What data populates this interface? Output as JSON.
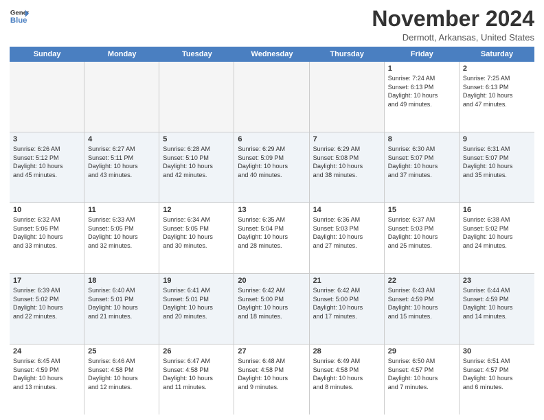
{
  "logo": {
    "line1": "General",
    "line2": "Blue"
  },
  "title": "November 2024",
  "location": "Dermott, Arkansas, United States",
  "header_days": [
    "Sunday",
    "Monday",
    "Tuesday",
    "Wednesday",
    "Thursday",
    "Friday",
    "Saturday"
  ],
  "weeks": [
    [
      {
        "day": "",
        "info": ""
      },
      {
        "day": "",
        "info": ""
      },
      {
        "day": "",
        "info": ""
      },
      {
        "day": "",
        "info": ""
      },
      {
        "day": "",
        "info": ""
      },
      {
        "day": "1",
        "info": "Sunrise: 7:24 AM\nSunset: 6:13 PM\nDaylight: 10 hours\nand 49 minutes."
      },
      {
        "day": "2",
        "info": "Sunrise: 7:25 AM\nSunset: 6:13 PM\nDaylight: 10 hours\nand 47 minutes."
      }
    ],
    [
      {
        "day": "3",
        "info": "Sunrise: 6:26 AM\nSunset: 5:12 PM\nDaylight: 10 hours\nand 45 minutes."
      },
      {
        "day": "4",
        "info": "Sunrise: 6:27 AM\nSunset: 5:11 PM\nDaylight: 10 hours\nand 43 minutes."
      },
      {
        "day": "5",
        "info": "Sunrise: 6:28 AM\nSunset: 5:10 PM\nDaylight: 10 hours\nand 42 minutes."
      },
      {
        "day": "6",
        "info": "Sunrise: 6:29 AM\nSunset: 5:09 PM\nDaylight: 10 hours\nand 40 minutes."
      },
      {
        "day": "7",
        "info": "Sunrise: 6:29 AM\nSunset: 5:08 PM\nDaylight: 10 hours\nand 38 minutes."
      },
      {
        "day": "8",
        "info": "Sunrise: 6:30 AM\nSunset: 5:07 PM\nDaylight: 10 hours\nand 37 minutes."
      },
      {
        "day": "9",
        "info": "Sunrise: 6:31 AM\nSunset: 5:07 PM\nDaylight: 10 hours\nand 35 minutes."
      }
    ],
    [
      {
        "day": "10",
        "info": "Sunrise: 6:32 AM\nSunset: 5:06 PM\nDaylight: 10 hours\nand 33 minutes."
      },
      {
        "day": "11",
        "info": "Sunrise: 6:33 AM\nSunset: 5:05 PM\nDaylight: 10 hours\nand 32 minutes."
      },
      {
        "day": "12",
        "info": "Sunrise: 6:34 AM\nSunset: 5:05 PM\nDaylight: 10 hours\nand 30 minutes."
      },
      {
        "day": "13",
        "info": "Sunrise: 6:35 AM\nSunset: 5:04 PM\nDaylight: 10 hours\nand 28 minutes."
      },
      {
        "day": "14",
        "info": "Sunrise: 6:36 AM\nSunset: 5:03 PM\nDaylight: 10 hours\nand 27 minutes."
      },
      {
        "day": "15",
        "info": "Sunrise: 6:37 AM\nSunset: 5:03 PM\nDaylight: 10 hours\nand 25 minutes."
      },
      {
        "day": "16",
        "info": "Sunrise: 6:38 AM\nSunset: 5:02 PM\nDaylight: 10 hours\nand 24 minutes."
      }
    ],
    [
      {
        "day": "17",
        "info": "Sunrise: 6:39 AM\nSunset: 5:02 PM\nDaylight: 10 hours\nand 22 minutes."
      },
      {
        "day": "18",
        "info": "Sunrise: 6:40 AM\nSunset: 5:01 PM\nDaylight: 10 hours\nand 21 minutes."
      },
      {
        "day": "19",
        "info": "Sunrise: 6:41 AM\nSunset: 5:01 PM\nDaylight: 10 hours\nand 20 minutes."
      },
      {
        "day": "20",
        "info": "Sunrise: 6:42 AM\nSunset: 5:00 PM\nDaylight: 10 hours\nand 18 minutes."
      },
      {
        "day": "21",
        "info": "Sunrise: 6:42 AM\nSunset: 5:00 PM\nDaylight: 10 hours\nand 17 minutes."
      },
      {
        "day": "22",
        "info": "Sunrise: 6:43 AM\nSunset: 4:59 PM\nDaylight: 10 hours\nand 15 minutes."
      },
      {
        "day": "23",
        "info": "Sunrise: 6:44 AM\nSunset: 4:59 PM\nDaylight: 10 hours\nand 14 minutes."
      }
    ],
    [
      {
        "day": "24",
        "info": "Sunrise: 6:45 AM\nSunset: 4:59 PM\nDaylight: 10 hours\nand 13 minutes."
      },
      {
        "day": "25",
        "info": "Sunrise: 6:46 AM\nSunset: 4:58 PM\nDaylight: 10 hours\nand 12 minutes."
      },
      {
        "day": "26",
        "info": "Sunrise: 6:47 AM\nSunset: 4:58 PM\nDaylight: 10 hours\nand 11 minutes."
      },
      {
        "day": "27",
        "info": "Sunrise: 6:48 AM\nSunset: 4:58 PM\nDaylight: 10 hours\nand 9 minutes."
      },
      {
        "day": "28",
        "info": "Sunrise: 6:49 AM\nSunset: 4:58 PM\nDaylight: 10 hours\nand 8 minutes."
      },
      {
        "day": "29",
        "info": "Sunrise: 6:50 AM\nSunset: 4:57 PM\nDaylight: 10 hours\nand 7 minutes."
      },
      {
        "day": "30",
        "info": "Sunrise: 6:51 AM\nSunset: 4:57 PM\nDaylight: 10 hours\nand 6 minutes."
      }
    ]
  ]
}
